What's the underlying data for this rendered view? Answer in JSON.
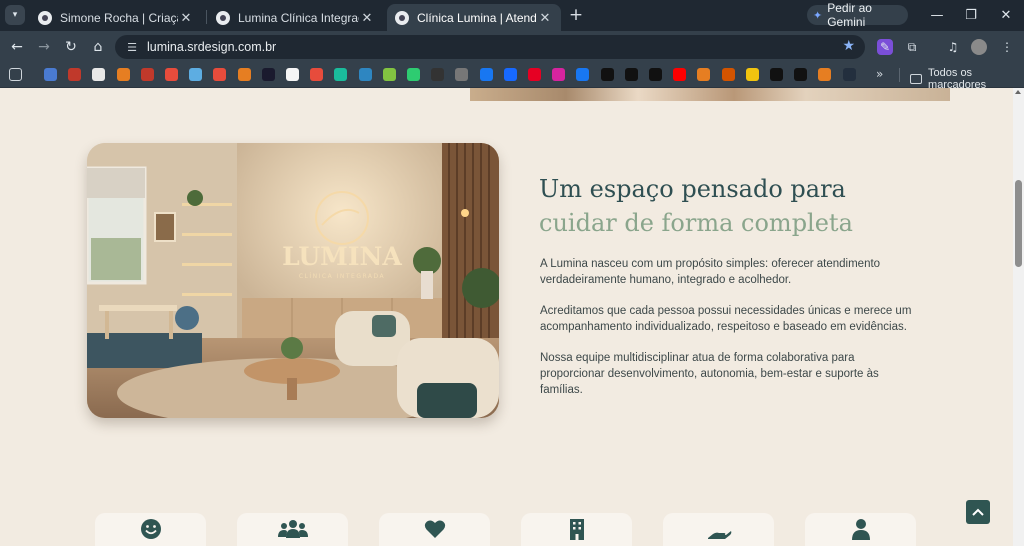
{
  "browser": {
    "tabs": [
      {
        "title": "Simone Rocha | Criação de Site",
        "active": false
      },
      {
        "title": "Lumina Clínica Integrada -",
        "active": false
      },
      {
        "title": "Clínica Lumina | Atendimento M",
        "active": true
      }
    ],
    "gemini_label": "Pedir ao Gemini",
    "url": "lumina.srdesign.com.br",
    "bookmarks_folder_label": "Todos os marcadores",
    "bookmark_icons": [
      "apps-icon",
      "puzzle-icon",
      "package-icon",
      "c-icon",
      "cp-icon",
      "pdf-icon",
      "heart-icon",
      "gem-icon",
      "ring-icon",
      "flame-icon",
      "v-icon",
      "m-icon",
      "d-icon",
      "v2-icon",
      "bird-icon",
      "leaf-icon",
      "px-icon",
      "p-icon",
      "grid-icon",
      "meta-icon",
      "be-icon",
      "pinterest-icon",
      "instagram-icon",
      "facebook-icon",
      "tiktok-icon",
      "threads-icon",
      "capcut-icon",
      "youtube-icon",
      "spiral-icon",
      "bag-icon",
      "coin-icon",
      "s-icon",
      "s2-icon",
      "box-icon",
      "amazon-icon"
    ]
  },
  "photo": {
    "logo_name": "LUMINA",
    "logo_tagline": "CLÍNICA INTEGRADA"
  },
  "about": {
    "heading_line1": "Um espaço pensado para",
    "heading_line2": "cuidar de forma completa",
    "paragraph1": "A Lumina nasceu com um propósito simples: oferecer atendimento verdadeiramente humano, integrado e acolhedor.",
    "paragraph2": "Acreditamos que cada pessoa possui necessidades únicas e merece um acompanhamento individualizado, respeitoso e baseado em evidências.",
    "paragraph3": "Nossa equipe multidisciplinar atua de forma colaborativa para proporcionar desenvolvimento, autonomia, bem-estar  e suporte às famílias."
  },
  "feature_cards": [
    {
      "icon": "smile-icon"
    },
    {
      "icon": "users-icon"
    },
    {
      "icon": "heart-icon"
    },
    {
      "icon": "building-icon"
    },
    {
      "icon": "hand-icon"
    },
    {
      "icon": "user-icon"
    }
  ],
  "colors": {
    "heading": "#2f4f52",
    "accent": "#8aa58c",
    "page_bg": "#f2ebe1",
    "button": "#2f5552"
  }
}
